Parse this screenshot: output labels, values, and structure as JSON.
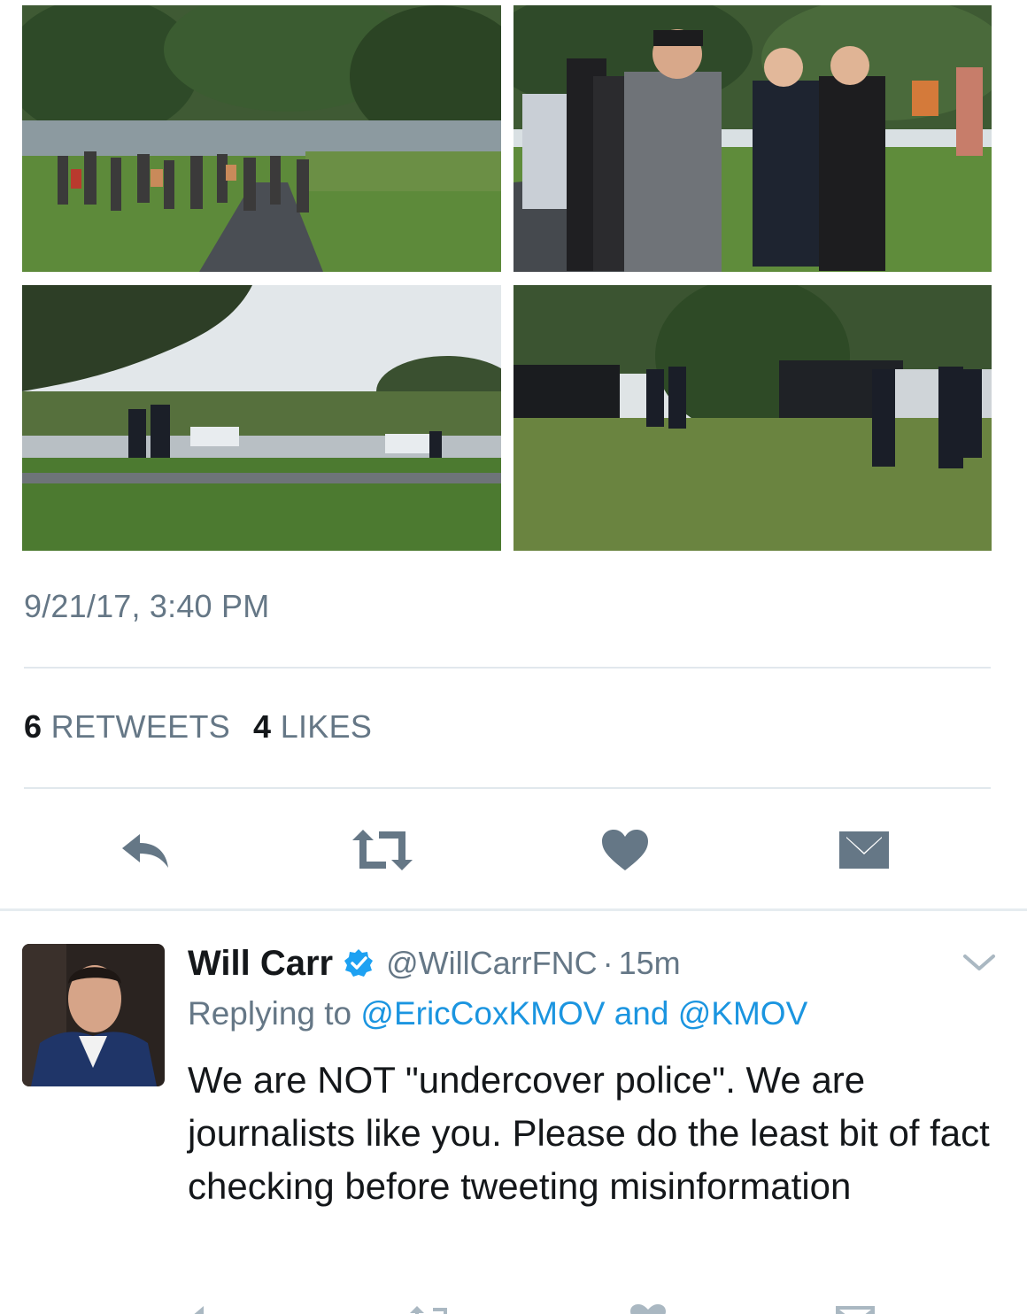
{
  "tweet": {
    "photos": [
      {
        "name": "Protesters gathered on park path"
      },
      {
        "name": "Men talking with police officer"
      },
      {
        "name": "Police officers near parked cruisers"
      },
      {
        "name": "Officers standing by patrol SUVs on grass"
      }
    ],
    "timestamp": "9/21/17, 3:40 PM",
    "stats": {
      "retweets_count": "6",
      "retweets_label": "RETWEETS",
      "likes_count": "4",
      "likes_label": "LIKES"
    },
    "actions": {
      "reply_icon": "reply-icon",
      "retweet_icon": "retweet-icon",
      "like_icon": "heart-icon",
      "dm_icon": "envelope-icon"
    }
  },
  "reply": {
    "author_name": "Will Carr",
    "verified_icon": "verified-badge-icon",
    "handle": "@WillCarrFNC",
    "separator": "·",
    "time": "15m",
    "replying_prefix": "Replying to",
    "mention_1": "@EricCoxKMOV",
    "replying_and": "and",
    "mention_2": "@KMOV",
    "text": "We are NOT \"undercover police\". We are journalists like you. Please do the least bit of fact checking before tweeting misinformation"
  },
  "colors": {
    "text_primary": "#14171a",
    "text_secondary": "#657786",
    "link": "#1b95e0",
    "icon": "#657786",
    "divider": "#e1e8ed"
  }
}
